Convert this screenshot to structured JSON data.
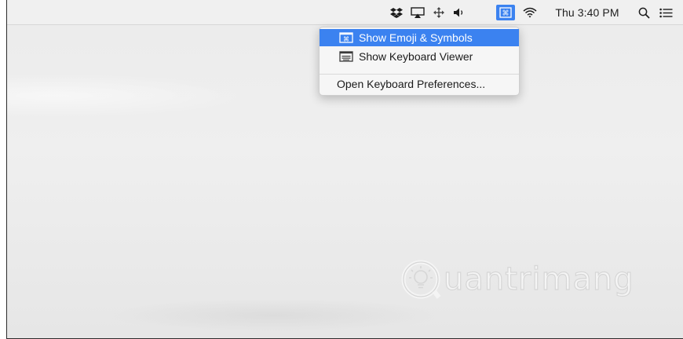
{
  "menubar": {
    "icons": [
      "dropbox-icon",
      "airplay-icon",
      "drag-arrows-icon",
      "volume-icon",
      "input-menu-icon",
      "wifi-icon",
      "spotlight-icon",
      "notification-center-icon"
    ],
    "clock": "Thu 3:40 PM"
  },
  "input_menu": {
    "items": [
      {
        "label": "Show Emoji & Symbols",
        "icon": "emoji-viewer-icon",
        "highlighted": true
      },
      {
        "label": "Show Keyboard Viewer",
        "icon": "keyboard-viewer-icon",
        "highlighted": false
      },
      {
        "label": "Open Keyboard Preferences...",
        "highlighted": false
      }
    ]
  },
  "watermark": {
    "text": "uantrimang",
    "logo": "quantrimang-logo-icon"
  },
  "colors": {
    "highlight": "#3b82f0",
    "menubar": "#f0f0f0",
    "menu_bg": "#f6f6f6"
  }
}
